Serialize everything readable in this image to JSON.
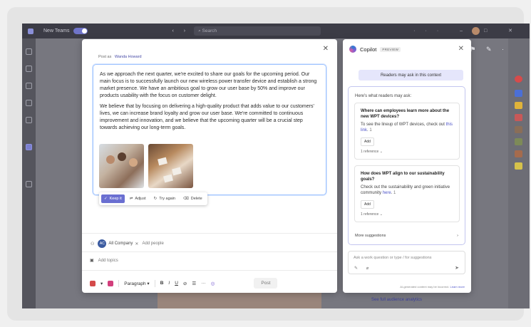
{
  "titlebar": {
    "new_teams": "New Teams",
    "search_placeholder": "Search",
    "nav": "‹ ›",
    "window_controls": "··· – □ ✕"
  },
  "app_icons": "🔔 ⚑ ✎ ···",
  "background": {
    "link": "See full audience analytics"
  },
  "dialog": {
    "post_as_label": "Post as",
    "post_as_name": "Wanda Howard",
    "paragraph1": "As we approach the next quarter, we're excited to share our goals for the upcoming period. Our main focus is to successfully launch our new wireless power transfer device and establish a strong market presence. We have an ambitious goal to grow our user base by 50% and improve our products usability with the focus on customer delight.",
    "paragraph2": "We believe that by focusing on delivering a high-quality product that adds value to our customers' lives, we can increase brand loyalty and grow our user base. We're committed to continuous improvement and innovation, and we believe that the upcoming quarter will be a crucial step towards achieving our long-term goals.",
    "actions": {
      "keep": "Keep it",
      "adjust": "Adjust",
      "try_again": "Try again",
      "delete": "Delete"
    },
    "audience_chip": "All Company",
    "add_people": "Add people",
    "add_topics": "Add topics",
    "paragraph_style": "Paragraph",
    "post": "Post"
  },
  "copilot": {
    "title": "Copilot",
    "badge": "PREVIEW",
    "pill": "Readers may ask in this context",
    "intro": "Here's what readers may ask:",
    "qa": [
      {
        "question": "Where can employees learn more about the new WPT devices?",
        "answer_pre": "To see the lineup of WPT devices, check out ",
        "answer_link": "this link",
        "answer_post": ".",
        "button": "Add",
        "reference": "1 reference"
      },
      {
        "question": "How does WPT align to our sustainability goals?",
        "answer_pre": "Check out the sustainability and green initiative community ",
        "answer_link": "here",
        "answer_post": ".",
        "button": "Add",
        "reference": "1 reference"
      }
    ],
    "more": "More suggestions",
    "input_placeholder": "Ask a work question or type / for suggestions",
    "footer_text": "AI-generated content may be incorrect.",
    "footer_link": "Learn more"
  }
}
